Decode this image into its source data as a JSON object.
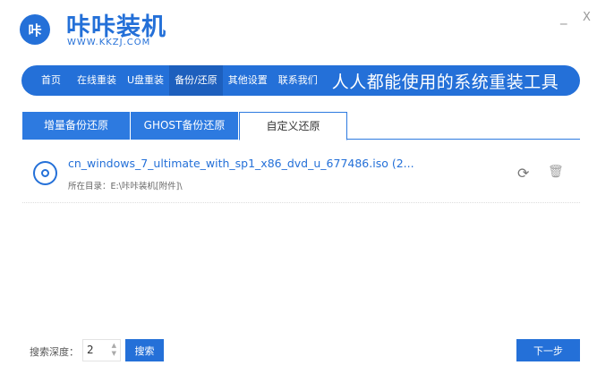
{
  "app": {
    "logo_text": "咔",
    "title": "咔咔装机",
    "url": "WWW.KKZJ.COM",
    "minimize": "_",
    "close": "X"
  },
  "nav": {
    "items": [
      "首页",
      "在线重装",
      "U盘重装",
      "备份/还原",
      "其他设置",
      "联系我们"
    ],
    "active": 3,
    "slogan": "人人都能使用的系统重装工具"
  },
  "tabs": {
    "items": [
      "增量备份还原",
      "GHOST备份还原",
      "自定义还原"
    ],
    "active": 2
  },
  "list": [
    {
      "name": "cn_windows_7_ultimate_with_sp1_x86_dvd_u_677486.iso (2...",
      "path": "所在目录：E:\\咔咔装机[附件]\\"
    }
  ],
  "icons": {
    "refresh": "⟳",
    "delete": "🗑"
  },
  "footer": {
    "depth_label": "搜索深度：",
    "depth_value": "2",
    "search": "搜索",
    "next": "下一步"
  },
  "colors": {
    "accent": "#2470d8"
  }
}
